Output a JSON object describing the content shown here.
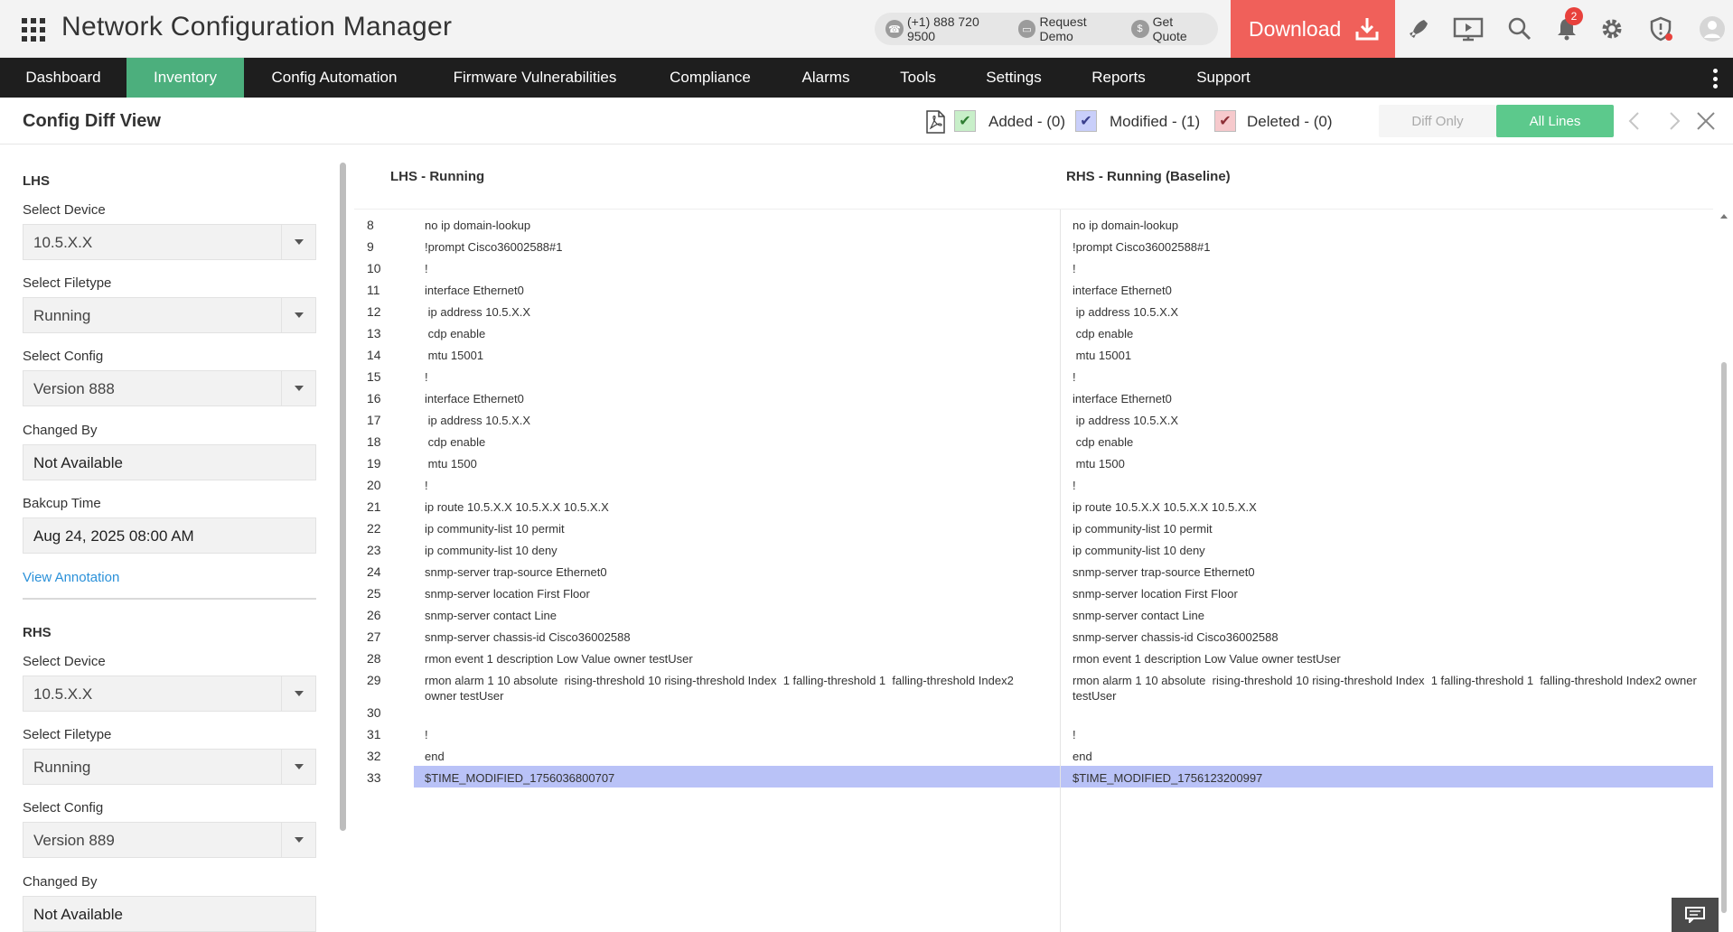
{
  "app": {
    "title": "Network Configuration Manager",
    "phone": "(+1) 888 720 9500",
    "request_demo": "Request Demo",
    "get_quote": "Get Quote",
    "download": "Download",
    "notification_count": "2"
  },
  "nav": {
    "items": [
      "Dashboard",
      "Inventory",
      "Config Automation",
      "Firmware Vulnerabilities",
      "Compliance",
      "Alarms",
      "Tools",
      "Settings",
      "Reports",
      "Support"
    ],
    "active": "Inventory"
  },
  "subheader": {
    "title": "Config Diff View",
    "added": "Added - (0)",
    "modified": "Modified - (1)",
    "deleted": "Deleted - (0)",
    "diff_only": "Diff Only",
    "all_lines": "All Lines"
  },
  "lhs": {
    "title": "LHS",
    "device_label": "Select Device",
    "device": "10.5.X.X",
    "filetype_label": "Select Filetype",
    "filetype": "Running",
    "config_label": "Select Config",
    "config": "Version 888",
    "changed_by_label": "Changed By",
    "changed_by": "Not Available",
    "backup_label": "Bakcup Time",
    "backup_time": "Aug 24, 2025 08:00 AM",
    "view_annotation": "View Annotation"
  },
  "rhs": {
    "title": "RHS",
    "device_label": "Select Device",
    "device": "10.5.X.X",
    "filetype_label": "Select Filetype",
    "filetype": "Running",
    "config_label": "Select Config",
    "config": "Version 889",
    "changed_by_label": "Changed By",
    "changed_by": "Not Available"
  },
  "diff": {
    "lhs_header": "LHS - Running",
    "rhs_header": "RHS - Running (Baseline)",
    "lines": [
      {
        "n": "8",
        "l": "no ip domain-lookup",
        "r": "no ip domain-lookup"
      },
      {
        "n": "9",
        "l": "!prompt Cisco36002588#1",
        "r": "!prompt Cisco36002588#1"
      },
      {
        "n": "10",
        "l": "!",
        "r": "!"
      },
      {
        "n": "11",
        "l": "interface Ethernet0",
        "r": "interface Ethernet0"
      },
      {
        "n": "12",
        "l": " ip address 10.5.X.X",
        "r": " ip address 10.5.X.X"
      },
      {
        "n": "13",
        "l": " cdp enable",
        "r": " cdp enable"
      },
      {
        "n": "14",
        "l": " mtu 15001",
        "r": " mtu 15001"
      },
      {
        "n": "15",
        "l": "!",
        "r": "!"
      },
      {
        "n": "16",
        "l": "interface Ethernet0",
        "r": "interface Ethernet0"
      },
      {
        "n": "17",
        "l": " ip address 10.5.X.X",
        "r": " ip address 10.5.X.X"
      },
      {
        "n": "18",
        "l": " cdp enable",
        "r": " cdp enable"
      },
      {
        "n": "19",
        "l": " mtu 1500",
        "r": " mtu 1500"
      },
      {
        "n": "20",
        "l": "!",
        "r": "!"
      },
      {
        "n": "21",
        "l": "ip route 10.5.X.X 10.5.X.X 10.5.X.X",
        "r": "ip route 10.5.X.X 10.5.X.X 10.5.X.X"
      },
      {
        "n": "22",
        "l": "ip community-list 10 permit",
        "r": "ip community-list 10 permit"
      },
      {
        "n": "23",
        "l": "ip community-list 10 deny",
        "r": "ip community-list 10 deny"
      },
      {
        "n": "24",
        "l": "snmp-server trap-source Ethernet0",
        "r": "snmp-server trap-source Ethernet0"
      },
      {
        "n": "25",
        "l": "snmp-server location First Floor",
        "r": "snmp-server location First Floor"
      },
      {
        "n": "26",
        "l": "snmp-server contact Line",
        "r": "snmp-server contact Line"
      },
      {
        "n": "27",
        "l": "snmp-server chassis-id Cisco36002588",
        "r": "snmp-server chassis-id Cisco36002588"
      },
      {
        "n": "28",
        "l": "rmon event 1 description Low Value owner testUser",
        "r": "rmon event 1 description Low Value owner testUser"
      },
      {
        "n": "29",
        "l": "rmon alarm 1 10 absolute  rising-threshold 10 rising-threshold Index  1 falling-threshold 1  falling-threshold Index2 owner testUser",
        "r": "rmon alarm 1 10 absolute  rising-threshold 10 rising-threshold Index  1 falling-threshold 1  falling-threshold Index2 owner testUser"
      },
      {
        "n": "30",
        "l": "",
        "r": ""
      },
      {
        "n": "31",
        "l": "!",
        "r": "!"
      },
      {
        "n": "32",
        "l": "end",
        "r": "end"
      },
      {
        "n": "33",
        "l": "$TIME_MODIFIED_1756036800707",
        "r": "$TIME_MODIFIED_1756123200997",
        "modified": true
      }
    ]
  },
  "colors": {
    "accent_green": "#4caf7d",
    "download_red": "#f0605a",
    "modified_blue": "#b9c2f7",
    "nav_bg": "#1e1e1e"
  }
}
